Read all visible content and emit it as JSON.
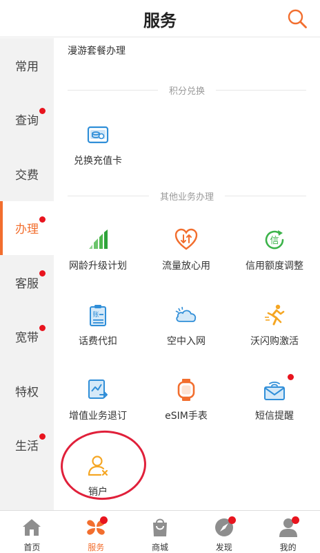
{
  "header": {
    "title": "服务"
  },
  "colors": {
    "accent": "#f26e2e",
    "badge": "#e8141e",
    "icon_blue": "#2f8ed8",
    "icon_green": "#3cb34a",
    "icon_orange": "#f5a623",
    "circle": "#e0203a"
  },
  "sidebar": {
    "items": [
      {
        "label": "常用"
      },
      {
        "label": "查询"
      },
      {
        "label": "交费"
      },
      {
        "label": "办理"
      },
      {
        "label": "客服"
      },
      {
        "label": "宽带"
      },
      {
        "label": "特权"
      },
      {
        "label": "生活"
      }
    ]
  },
  "main": {
    "top_item": "漫游套餐办理",
    "sections": [
      {
        "title": "积分兑换",
        "tiles": [
          {
            "label": "兑换充值卡",
            "icon": "recharge-card-icon"
          }
        ]
      },
      {
        "title": "其他业务办理",
        "tiles": [
          {
            "label": "网龄升级计划",
            "icon": "signal-bars-icon"
          },
          {
            "label": "流量放心用",
            "icon": "heart-data-icon"
          },
          {
            "label": "信用额度调整",
            "icon": "credit-icon"
          },
          {
            "label": "话费代扣",
            "icon": "bill-clipboard-icon"
          },
          {
            "label": "空中入网",
            "icon": "cloud-icon"
          },
          {
            "label": "沃闪购激活",
            "icon": "running-man-icon"
          },
          {
            "label": "增值业务退订",
            "icon": "unsubscribe-icon"
          },
          {
            "label": "eSIM手表",
            "icon": "watch-icon"
          },
          {
            "label": "短信提醒",
            "icon": "sms-envelope-icon"
          },
          {
            "label": "销户",
            "icon": "user-remove-icon"
          }
        ]
      }
    ]
  },
  "tabbar": {
    "items": [
      {
        "label": "首页",
        "icon": "home-icon"
      },
      {
        "label": "服务",
        "icon": "service-clover-icon"
      },
      {
        "label": "商城",
        "icon": "shopping-bag-icon"
      },
      {
        "label": "发现",
        "icon": "compass-icon"
      },
      {
        "label": "我的",
        "icon": "profile-icon"
      }
    ]
  }
}
